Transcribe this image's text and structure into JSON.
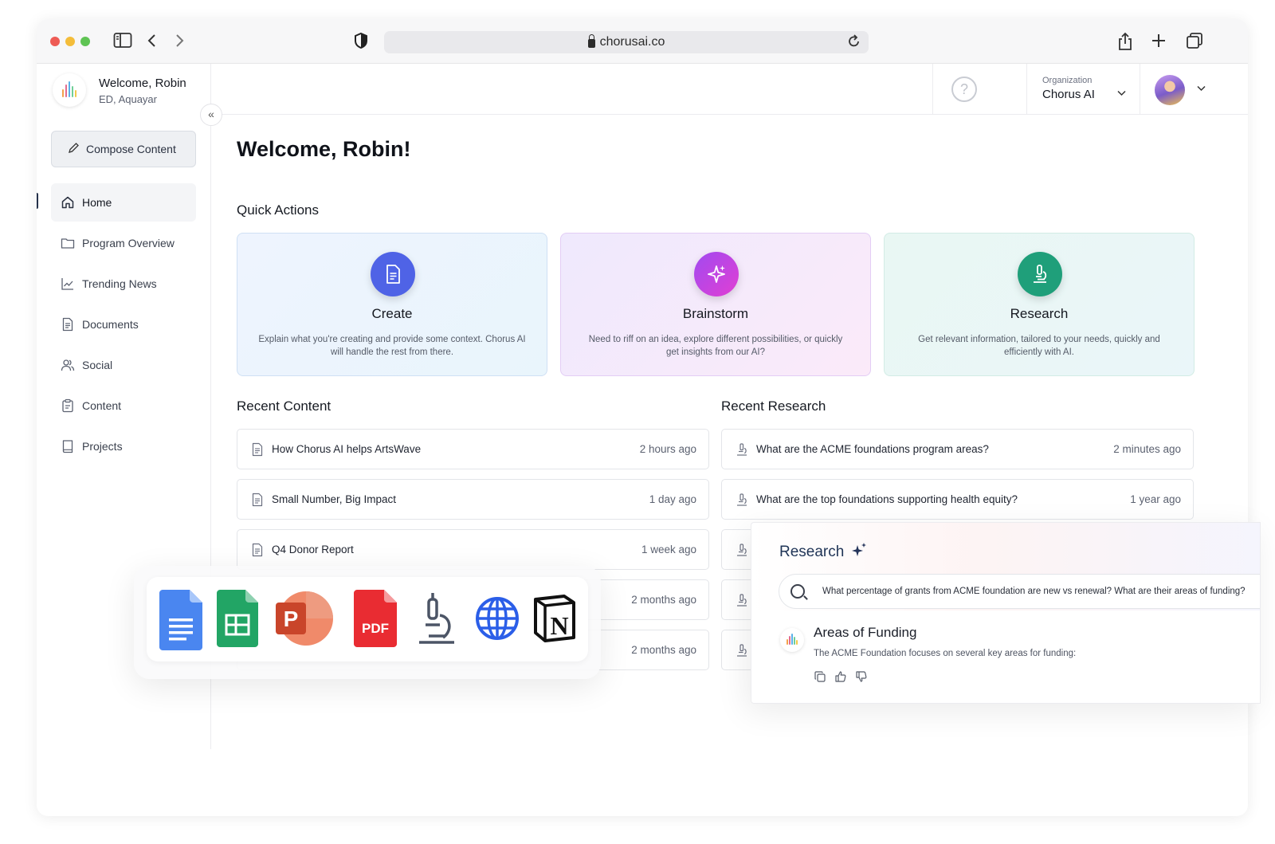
{
  "browser": {
    "url": "chorusai.co"
  },
  "sidebar": {
    "user_name": "Welcome, Robin",
    "user_role": "ED, Aquayar",
    "compose_label": "Compose Content",
    "items": [
      {
        "label": "Home",
        "icon": "home-icon"
      },
      {
        "label": "Program Overview",
        "icon": "folder-icon"
      },
      {
        "label": "Trending News",
        "icon": "trend-chart-icon"
      },
      {
        "label": "Documents",
        "icon": "document-icon"
      },
      {
        "label": "Social",
        "icon": "users-icon"
      },
      {
        "label": "Content",
        "icon": "clipboard-icon"
      },
      {
        "label": "Projects",
        "icon": "book-icon"
      }
    ]
  },
  "header": {
    "org_label": "Organization",
    "org_name": "Chorus AI"
  },
  "main": {
    "title": "Welcome, Robin!",
    "quick_actions_title": "Quick Actions",
    "quick_actions": [
      {
        "title": "Create",
        "description": "Explain what you're creating and provide some context. Chorus AI will handle the rest from there.",
        "color": "#4f63e6"
      },
      {
        "title": "Brainstorm",
        "description": "Need to riff on an idea, explore different possibilities, or quickly get insights from our AI?",
        "color": "#c13fe8"
      },
      {
        "title": "Research",
        "description": "Get relevant information, tailored to your needs, quickly and efficiently with AI.",
        "color": "#1f9f7a"
      }
    ],
    "recent_content_title": "Recent Content",
    "recent_content": [
      {
        "label": "How Chorus AI helps ArtsWave",
        "time": "2 hours ago"
      },
      {
        "label": "Small Number, Big Impact",
        "time": "1 day ago"
      },
      {
        "label": "Q4 Donor Report",
        "time": "1 week ago"
      },
      {
        "label": "",
        "time": "2 months ago"
      },
      {
        "label": "",
        "time": "2 months ago"
      }
    ],
    "recent_research_title": "Recent Research",
    "recent_research": [
      {
        "label": "What are the ACME foundations program areas?",
        "time": "2 minutes ago"
      },
      {
        "label": "What are the top foundations supporting health equity?",
        "time": "1 year ago"
      }
    ]
  },
  "integrations": {
    "pdf_label": "PDF",
    "notion_letter": "N",
    "powerpoint_letter": "P",
    "icons": [
      "google-docs-icon",
      "google-sheets-icon",
      "powerpoint-icon",
      "pdf-icon",
      "microscope-icon",
      "globe-icon",
      "notion-icon"
    ]
  },
  "research_panel": {
    "title": "Research",
    "query": "What percentage of grants from ACME foundation are new vs renewal? What are their areas of funding?",
    "answer_heading": "Areas of Funding",
    "answer_text": "The ACME Foundation focuses on several key areas for funding:"
  }
}
